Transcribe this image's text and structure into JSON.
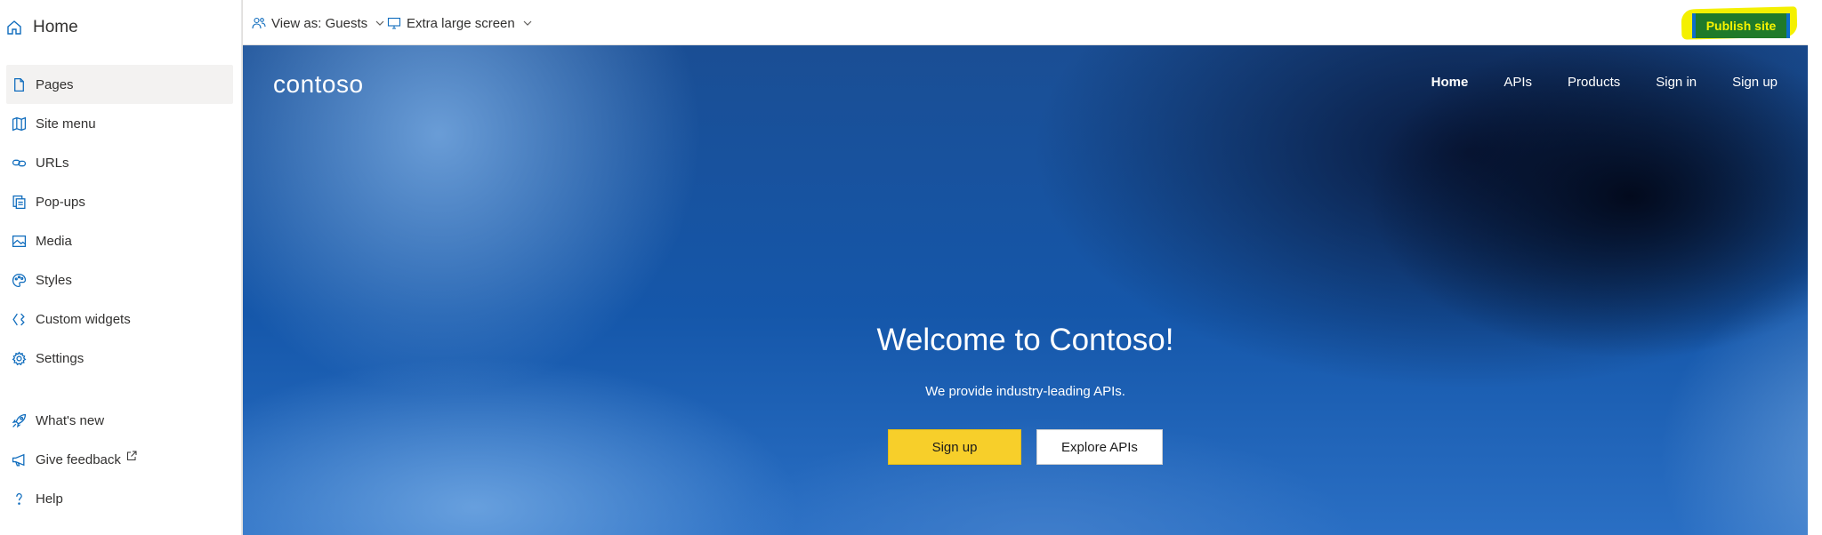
{
  "sidebar": {
    "home": "Home",
    "items": [
      {
        "label": "Pages",
        "icon": "page-icon"
      },
      {
        "label": "Site menu",
        "icon": "map-icon"
      },
      {
        "label": "URLs",
        "icon": "link-icon"
      },
      {
        "label": "Pop-ups",
        "icon": "popup-icon"
      },
      {
        "label": "Media",
        "icon": "image-icon"
      },
      {
        "label": "Styles",
        "icon": "palette-icon"
      },
      {
        "label": "Custom widgets",
        "icon": "widget-icon"
      },
      {
        "label": "Settings",
        "icon": "gear-icon"
      }
    ],
    "bottom_items": [
      {
        "label": "What's new",
        "icon": "rocket-icon"
      },
      {
        "label": "Give feedback",
        "icon": "megaphone-icon"
      },
      {
        "label": "Help",
        "icon": "question-icon"
      }
    ]
  },
  "toolbar": {
    "view_as": "View as: Guests",
    "screen_size": "Extra large screen",
    "publish": "Publish site"
  },
  "site": {
    "logo": "contoso",
    "nav": [
      "Home",
      "APIs",
      "Products",
      "Sign in",
      "Sign up"
    ],
    "hero_title": "Welcome to Contoso!",
    "hero_subtitle": "We provide industry-leading APIs.",
    "signup_button": "Sign up",
    "explore_button": "Explore APIs"
  },
  "colors": {
    "publish_bg": "#1f7a2a",
    "publish_text": "#f7f300",
    "highlight": "#f4f000",
    "signup_yellow": "#f7cf2a"
  }
}
